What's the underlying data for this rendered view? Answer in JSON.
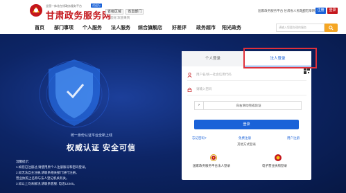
{
  "header": {
    "tagline": "全国一体化在线政务服务平台",
    "badge": "试运行",
    "title": "甘肃政务服务网",
    "region_select": "省级区域",
    "dept_select": "省直部门",
    "welcome": "您好,欢迎来到",
    "links": "国家政务服务平台  甘肃省人民政府",
    "accessible": "无障碍浏览",
    "register": "注册",
    "login": "登录"
  },
  "nav": {
    "items": [
      "首页",
      "部门事项",
      "个人服务",
      "法人服务",
      "综合旗舰店",
      "好差评",
      "政务超市",
      "阳光政务"
    ],
    "search_placeholder": "请输入您要办理的服务"
  },
  "hero": {
    "small": "统一身份认证平台全新上线",
    "big": "权威认证   安全可信",
    "notice_title": "温馨提示:",
    "notice_lines": [
      "1.如您已注册过,请使用原个人注册账号和密码登录。",
      "2.如无法自主注册,请联系相关部门进行注册。",
      "  营业执照上名称与法人登记机关有关。",
      "3.如以上均未解决,请联系客服: 电话12345。"
    ]
  },
  "login": {
    "tab_personal": "个人登录",
    "tab_legal": "法人登录",
    "username_placeholder": "用户名/统一社会信用代码",
    "password_placeholder": "请输入密码",
    "verify_text": "向右滑动完成验证",
    "submit": "登录",
    "forgot": "忘记密码?",
    "register_link": "免费注册",
    "user_register": "用户注册",
    "other_login": "其他方式登录",
    "alt1": "国家政务服务平台法人登录",
    "alt2": "电子营业执照登录"
  },
  "colors": {
    "brand_red": "#c4161c",
    "primary_blue": "#1a62d8",
    "search_orange": "#f5a623",
    "hero_dark": "#0d2566"
  }
}
